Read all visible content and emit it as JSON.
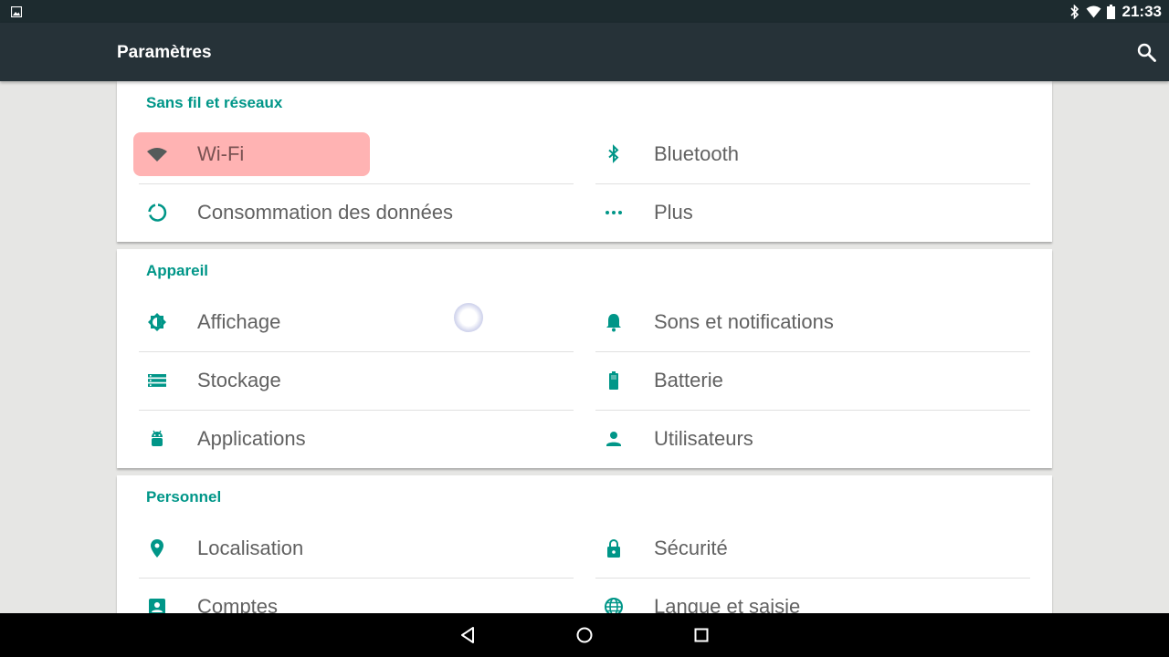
{
  "status_bar": {
    "time": "21:33",
    "icons": [
      "image-icon",
      "bluetooth-icon",
      "wifi-icon",
      "battery-icon"
    ]
  },
  "app_bar": {
    "title": "Paramètres",
    "search_icon": "search-icon"
  },
  "sections": [
    {
      "title": "Sans fil et réseaux",
      "items": [
        {
          "label": "Wi-Fi",
          "icon": "wifi-icon",
          "highlighted": true
        },
        {
          "label": "Bluetooth",
          "icon": "bluetooth-icon"
        },
        {
          "label": "Consommation des données",
          "icon": "data-usage-icon"
        },
        {
          "label": "Plus",
          "icon": "more-icon"
        }
      ]
    },
    {
      "title": "Appareil",
      "items": [
        {
          "label": "Affichage",
          "icon": "brightness-icon"
        },
        {
          "label": "Sons et notifications",
          "icon": "bell-icon"
        },
        {
          "label": "Stockage",
          "icon": "storage-icon"
        },
        {
          "label": "Batterie",
          "icon": "battery-icon"
        },
        {
          "label": "Applications",
          "icon": "android-icon"
        },
        {
          "label": "Utilisateurs",
          "icon": "person-icon"
        }
      ]
    },
    {
      "title": "Personnel",
      "items": [
        {
          "label": "Localisation",
          "icon": "location-pin-icon"
        },
        {
          "label": "Sécurité",
          "icon": "lock-icon"
        },
        {
          "label": "Comptes",
          "icon": "account-box-icon"
        },
        {
          "label": "Langue et saisie",
          "icon": "globe-icon"
        }
      ]
    }
  ],
  "nav_bar": {
    "buttons": [
      "back-icon",
      "home-icon",
      "recents-icon"
    ]
  },
  "colors": {
    "accent": "#009688",
    "app_bar": "#263238",
    "status_bar": "#1d2b2f",
    "wifi_highlight": "#ffb3b3",
    "item_text": "#616161"
  }
}
